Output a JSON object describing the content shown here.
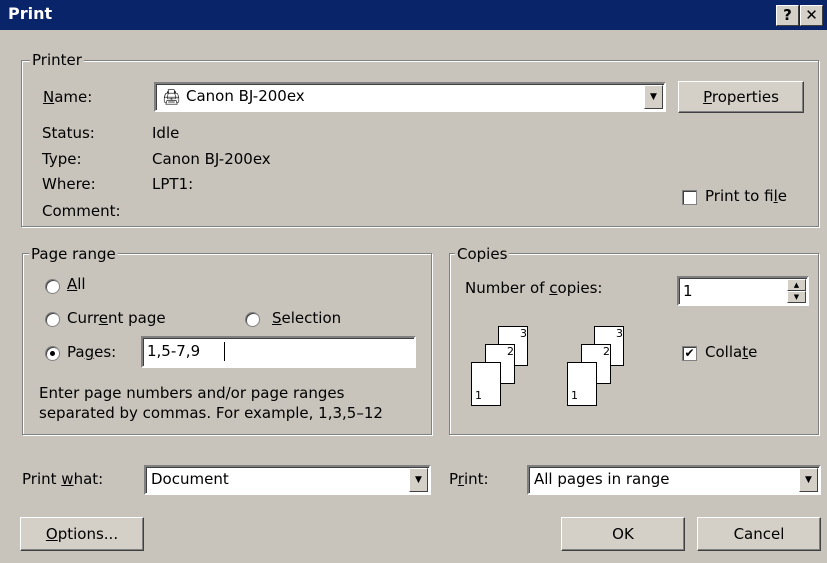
{
  "window": {
    "title": "Print",
    "help_label": "?",
    "close_label": "✕"
  },
  "printer": {
    "group_label": "Printer",
    "name_label": "Name:",
    "name_value": "Canon  BJ-200ex",
    "properties_label": "Properties",
    "status_label": "Status:",
    "status_value": "Idle",
    "type_label": "Type:",
    "type_value": "Canon  BJ-200ex",
    "where_label": "Where:",
    "where_value": "LPT1:",
    "comment_label": "Comment:",
    "print_to_file_label": "Print to file",
    "print_to_file_checked": false
  },
  "page_range": {
    "group_label": "Page range",
    "all_label": "All",
    "current_page_label": "Current page",
    "selection_label": "Selection",
    "pages_label": "Pages:",
    "pages_value": "1,5-7,9",
    "selected": "pages",
    "help_line1": "Enter page numbers and/or page ranges",
    "help_line2": "separated by commas.  For example, 1,3,5–12"
  },
  "copies": {
    "group_label": "Copies",
    "number_label": "Number of copies:",
    "number_value": "1",
    "collate_label": "Collate",
    "collate_checked": true,
    "page_numbers": [
      "3",
      "2",
      "1"
    ]
  },
  "print_what": {
    "label": "Print what:",
    "value": "Document"
  },
  "print": {
    "label": "Print:",
    "value": "All pages in range"
  },
  "buttons": {
    "options": "Options...",
    "ok": "OK",
    "cancel": "Cancel"
  },
  "icons": {
    "printer": "printer-icon",
    "dropdown": "dropdown-arrow-icon",
    "spin": "spin-arrows-icon"
  }
}
